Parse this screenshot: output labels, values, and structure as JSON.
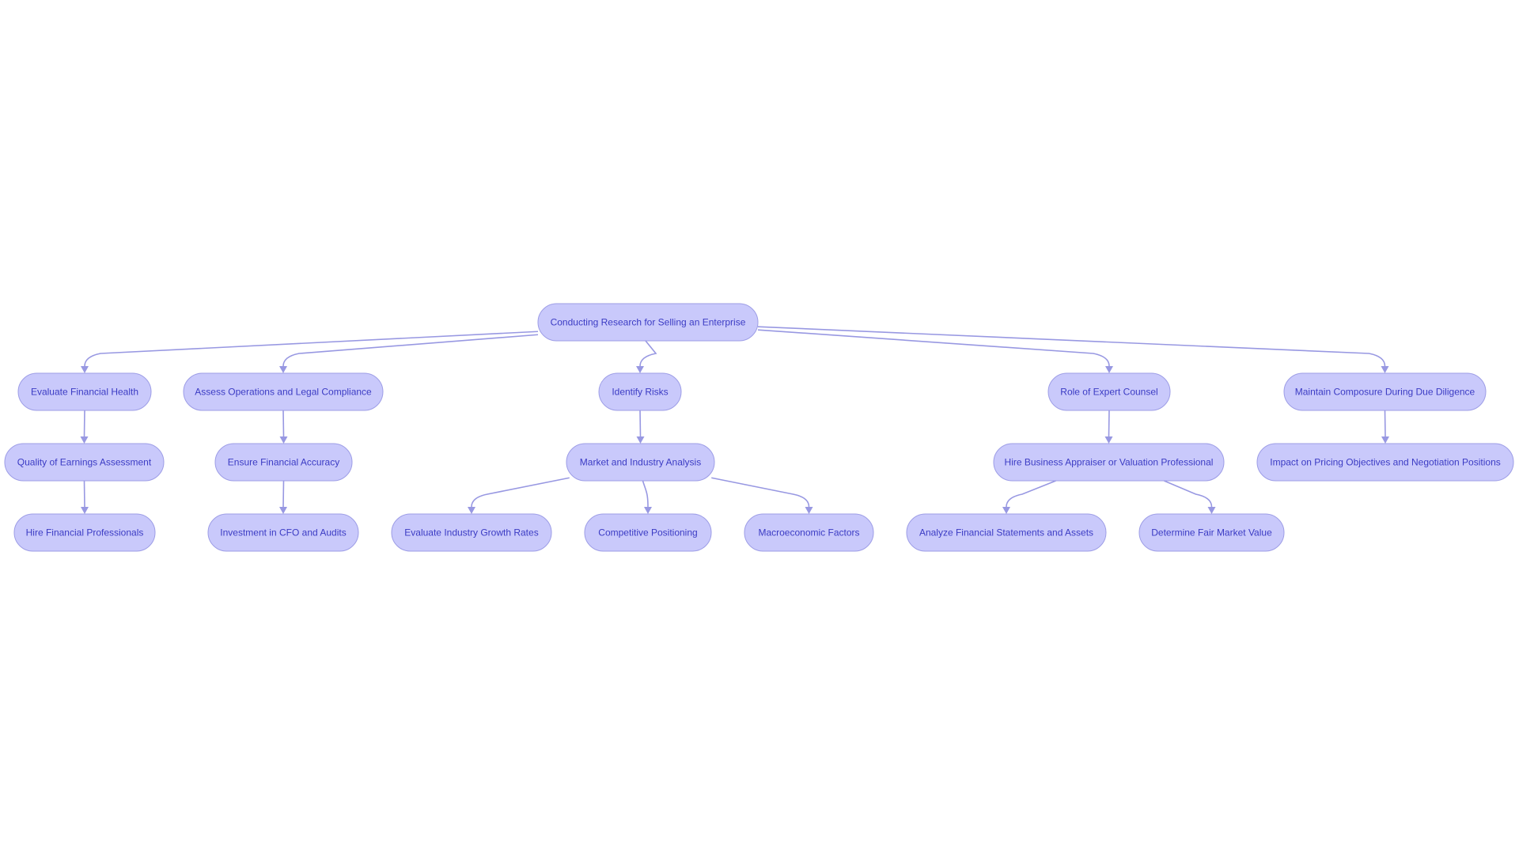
{
  "diagram": {
    "type": "flowchart-top-down",
    "colors": {
      "node_fill": "#c9c9fb",
      "node_border": "#9d9de6",
      "node_text": "#3b3bc4",
      "edge": "#9898e2",
      "background": "#ffffff"
    },
    "nodes": [
      {
        "id": "root",
        "label": "Conducting Research for Selling an Enterprise"
      },
      {
        "id": "efh",
        "label": "Evaluate Financial Health"
      },
      {
        "id": "aolc",
        "label": "Assess Operations and Legal Compliance"
      },
      {
        "id": "ir",
        "label": "Identify Risks"
      },
      {
        "id": "rec",
        "label": "Role of Expert Counsel"
      },
      {
        "id": "mcdd",
        "label": "Maintain Composure During Due Diligence"
      },
      {
        "id": "qea",
        "label": "Quality of Earnings Assessment"
      },
      {
        "id": "efa",
        "label": "Ensure Financial Accuracy"
      },
      {
        "id": "mia",
        "label": "Market and Industry Analysis"
      },
      {
        "id": "hba",
        "label": "Hire Business Appraiser or Valuation Professional"
      },
      {
        "id": "ipo",
        "label": "Impact on Pricing Objectives and Negotiation Positions"
      },
      {
        "id": "hfp",
        "label": "Hire Financial Professionals"
      },
      {
        "id": "icfo",
        "label": "Investment in CFO and Audits"
      },
      {
        "id": "eigr",
        "label": "Evaluate Industry Growth Rates"
      },
      {
        "id": "cp",
        "label": "Competitive Positioning"
      },
      {
        "id": "mf",
        "label": "Macroeconomic Factors"
      },
      {
        "id": "afsa",
        "label": "Analyze Financial Statements and Assets"
      },
      {
        "id": "dfmv",
        "label": "Determine Fair Market Value"
      }
    ],
    "edges": [
      {
        "from": "root",
        "to": "efh"
      },
      {
        "from": "root",
        "to": "aolc"
      },
      {
        "from": "root",
        "to": "ir"
      },
      {
        "from": "root",
        "to": "rec"
      },
      {
        "from": "root",
        "to": "mcdd"
      },
      {
        "from": "efh",
        "to": "qea"
      },
      {
        "from": "qea",
        "to": "hfp"
      },
      {
        "from": "aolc",
        "to": "efa"
      },
      {
        "from": "efa",
        "to": "icfo"
      },
      {
        "from": "ir",
        "to": "mia"
      },
      {
        "from": "mia",
        "to": "eigr"
      },
      {
        "from": "mia",
        "to": "cp"
      },
      {
        "from": "mia",
        "to": "mf"
      },
      {
        "from": "rec",
        "to": "hba"
      },
      {
        "from": "hba",
        "to": "afsa"
      },
      {
        "from": "hba",
        "to": "dfmv"
      },
      {
        "from": "mcdd",
        "to": "ipo"
      }
    ]
  }
}
